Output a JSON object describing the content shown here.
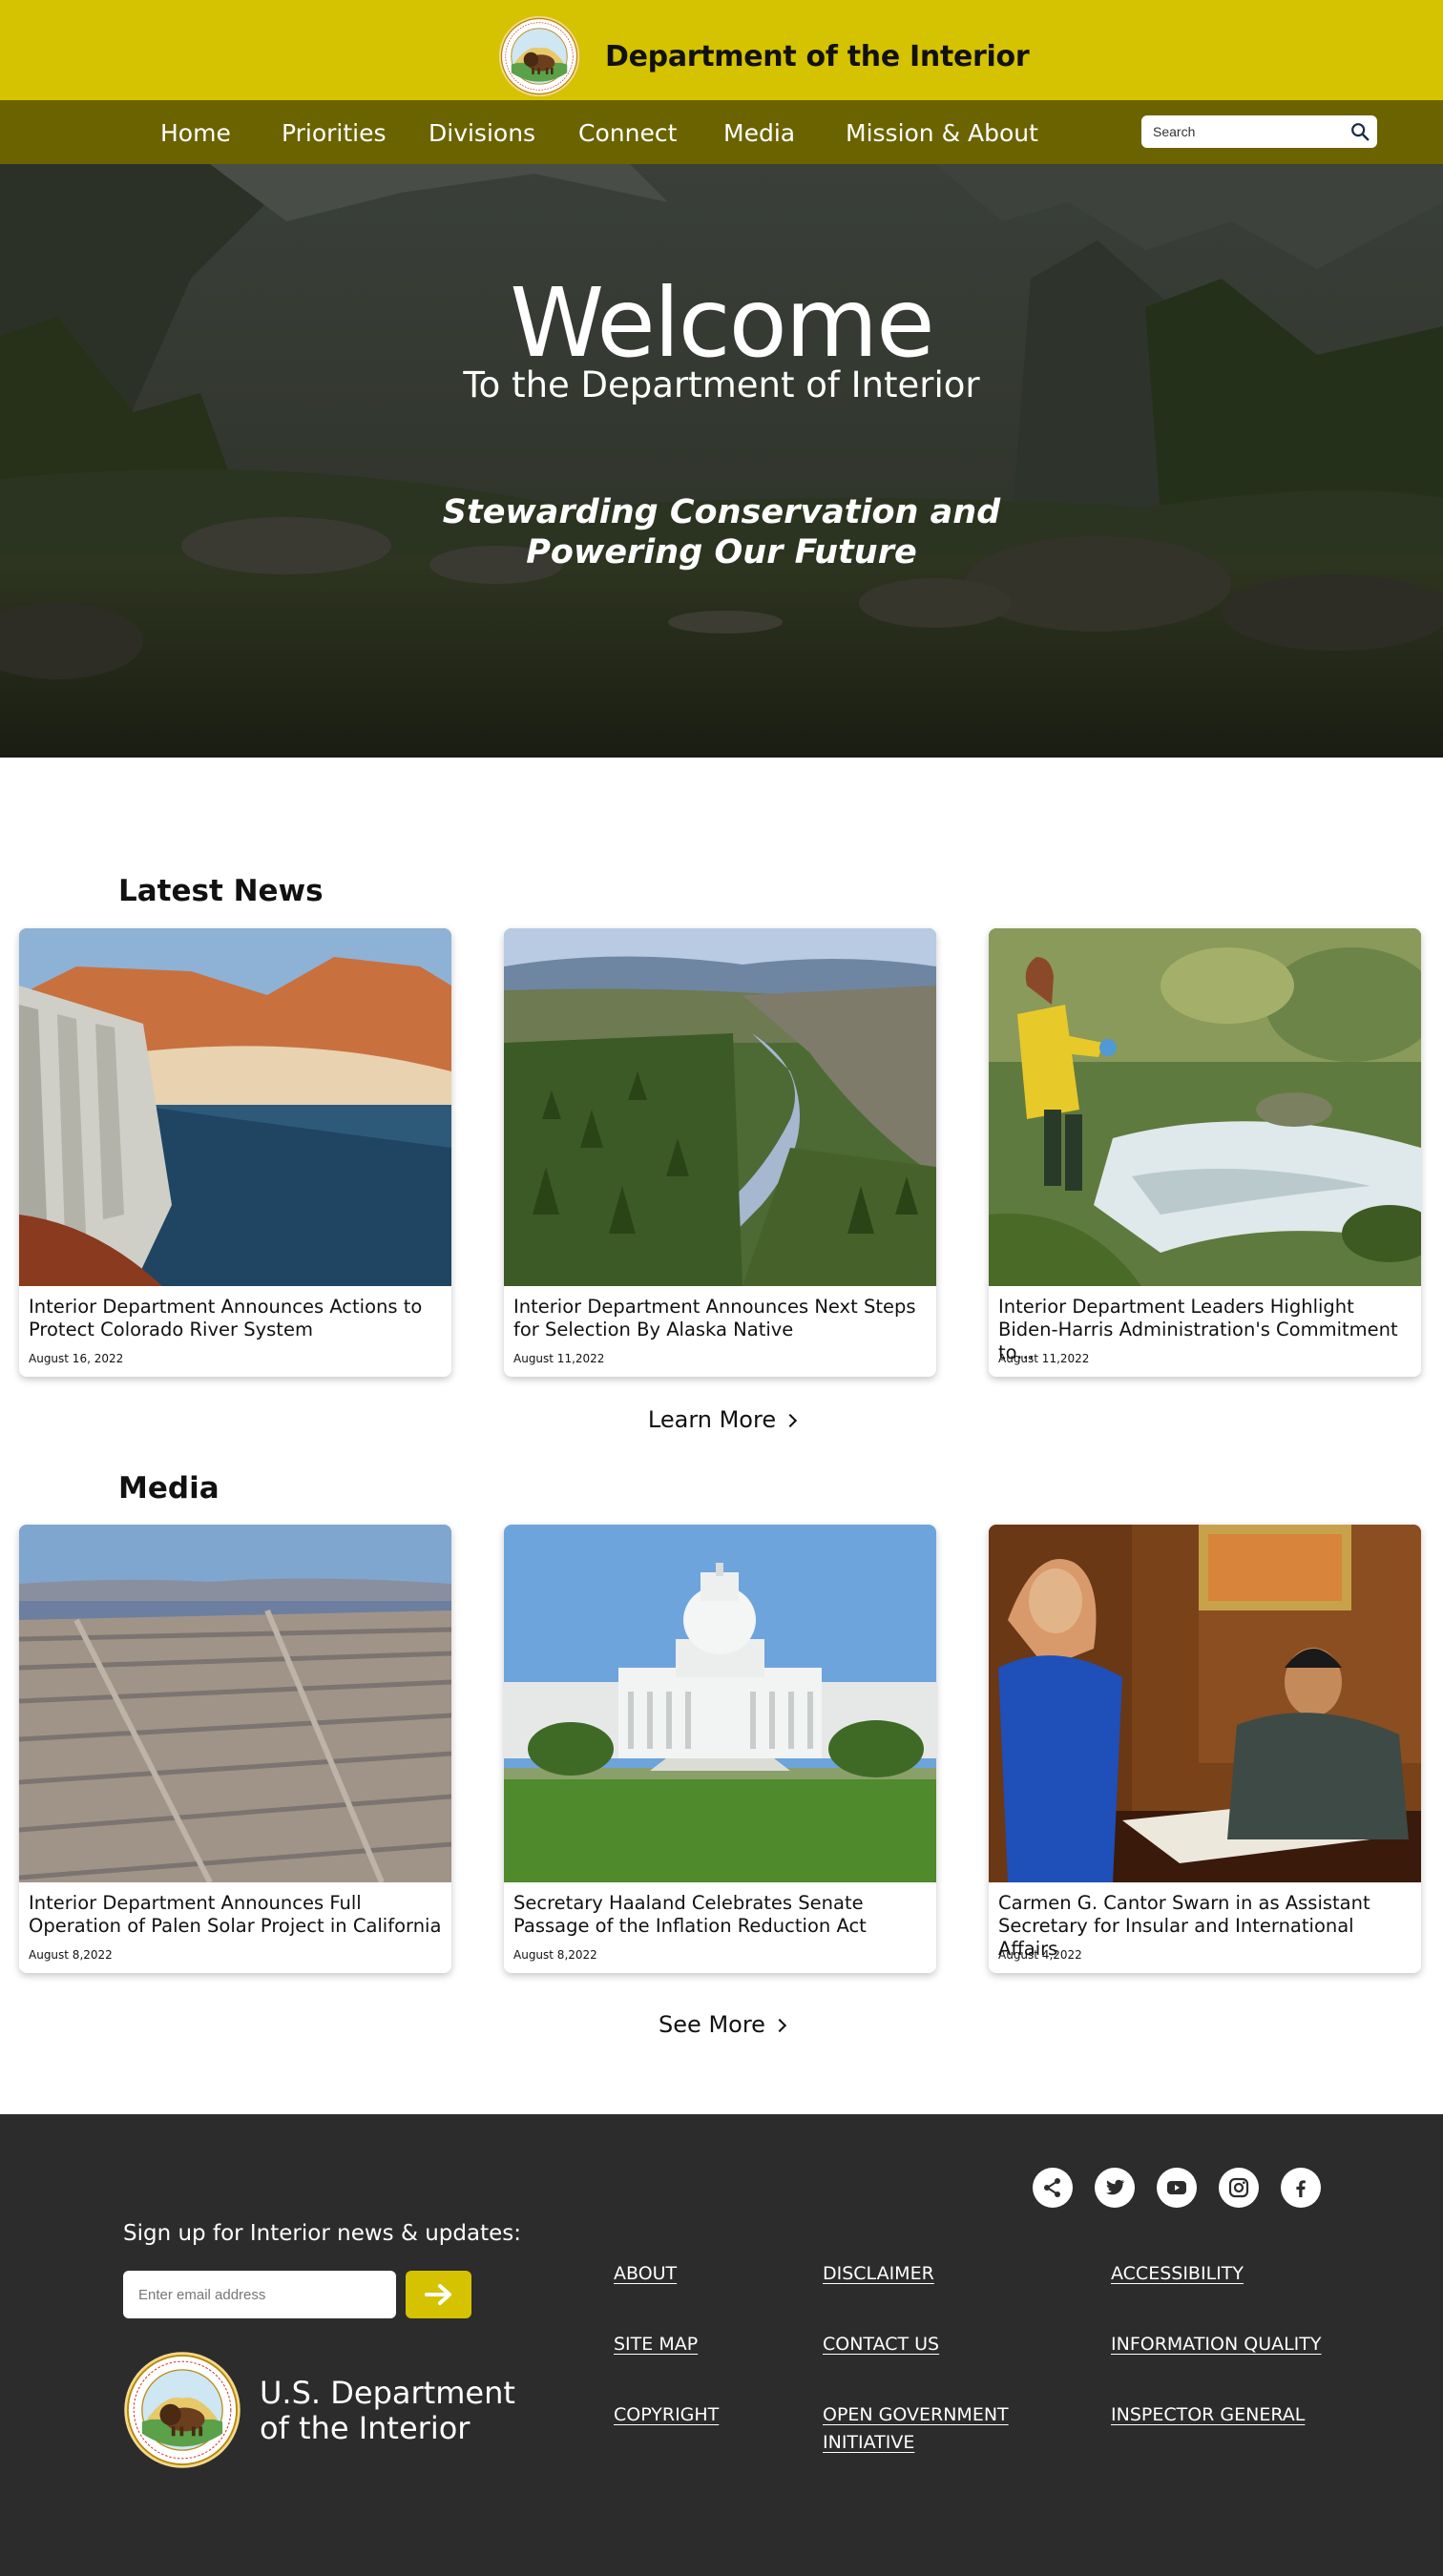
{
  "header": {
    "title": "Department of the Interior",
    "seal_text": "U.S. DEPARTMENT OF THE INTERIOR · MARCH 3, 1849"
  },
  "nav": {
    "items": [
      "Home",
      "Priorities",
      "Divisions",
      "Connect",
      "Media",
      "Mission & About"
    ],
    "search_placeholder": "Search"
  },
  "hero": {
    "welcome": "Welcome",
    "subtitle": "To the Department of Interior",
    "tagline": "Stewarding Conservation and Powering Our Future"
  },
  "latest_news": {
    "heading": "Latest News",
    "cards": [
      {
        "title": "Interior Department Announces Actions to Protect Colorado River System",
        "date": "August 16, 2022"
      },
      {
        "title": "Interior Department Announces Next Steps for Selection By Alaska Native",
        "date": "August 11,2022"
      },
      {
        "title": "Interior Department Leaders Highlight Biden-Harris Administration's Commitment to...",
        "date": "August 11,2022"
      }
    ],
    "more_label": "Learn More"
  },
  "media": {
    "heading": "Media",
    "cards": [
      {
        "title": "Interior Department Announces Full Operation of Palen Solar Project in California",
        "date": "August 8,2022"
      },
      {
        "title": "Secretary Haaland Celebrates Senate Passage of the Inflation Reduction Act",
        "date": "August 8,2022"
      },
      {
        "title": "Carmen G. Cantor Swarn in as Assistant Secretary for Insular and International Affairs",
        "date": "August 4,2022"
      }
    ],
    "more_label": "See More"
  },
  "footer": {
    "social_icons": [
      "share-icon",
      "twitter-icon",
      "youtube-icon",
      "instagram-icon",
      "facebook-icon"
    ],
    "signup_label": "Sign up for Interior news & updates:",
    "email_placeholder": "Enter email address",
    "brand_line1": "U.S. Department",
    "brand_line2": "of the Interior",
    "links": {
      "about": "ABOUT",
      "disclaimer": "DISCLAIMER",
      "accessibility": "ACCESSIBILITY",
      "site_map": "SITE MAP",
      "contact_us": "CONTACT US",
      "information_quality": "INFORMATION QUALITY",
      "copyright": "COPYRIGHT",
      "open_government_line1": "OPEN GOVERNMENT",
      "open_government_line2": "INITIATIVE",
      "inspector_general": "INSPECTOR GENERAL"
    }
  },
  "colors": {
    "brand_yellow": "#d5c200",
    "nav_olive": "#6b6300",
    "footer_dark": "#2c2c2c"
  }
}
